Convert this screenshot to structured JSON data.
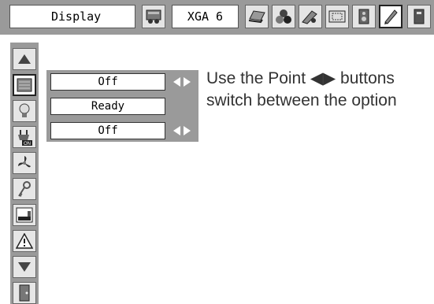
{
  "topbar": {
    "menu_title": "Display",
    "input_source": "XGA 6",
    "icons": [
      "projector-settings-icon",
      "laptop-icon",
      "color-balls-icon",
      "image-adjust-icon",
      "screen-size-icon",
      "speaker-icon",
      "setting-pen-icon",
      "info-icon"
    ]
  },
  "sidebar": {
    "items": [
      "up-arrow-icon",
      "display-icon",
      "lamp-icon",
      "power-on-icon",
      "fan-icon",
      "key-icon",
      "screen-icon",
      "warning-icon",
      "down-arrow-icon",
      "exit-icon"
    ]
  },
  "options": [
    {
      "value": "Off",
      "has_arrows": true
    },
    {
      "value": "Ready",
      "has_arrows": false
    },
    {
      "value": "Off",
      "has_arrows": true
    }
  ],
  "help": {
    "line1": "Use the Point ◀▶ buttons",
    "line2": "switch between the option"
  },
  "colors": {
    "bar_gray": "#9a9a9a",
    "field_white": "#ffffff",
    "text": "#333333"
  }
}
